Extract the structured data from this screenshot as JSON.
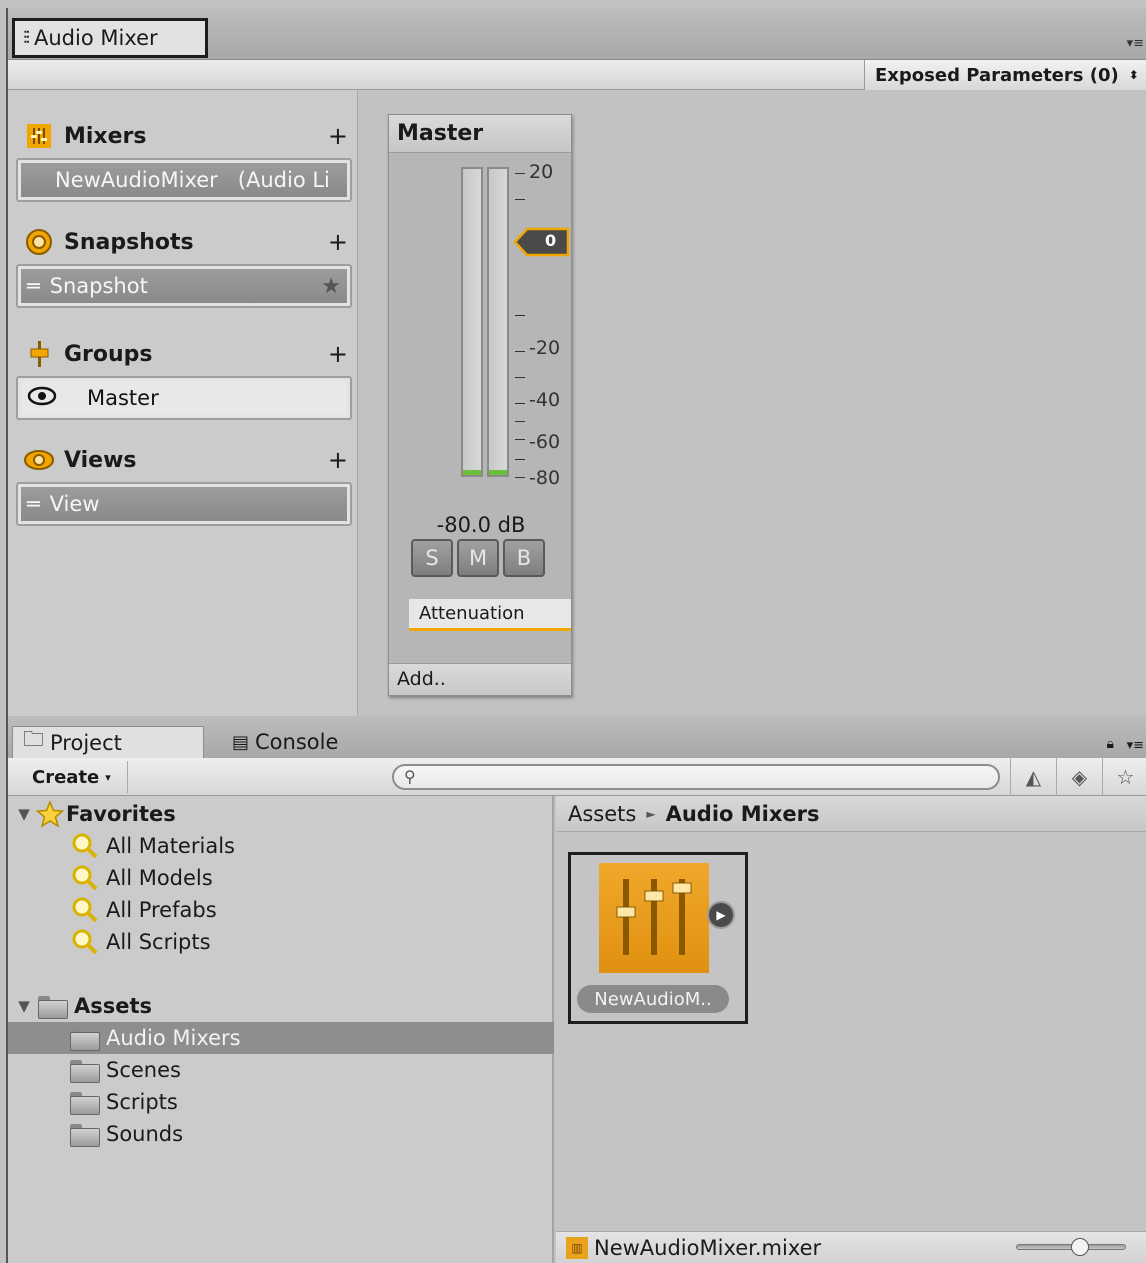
{
  "mixer_window": {
    "tab_title": "Audio Mixer",
    "exposed_parameters": "Exposed Parameters (0)",
    "sections": {
      "mixers": {
        "title": "Mixers",
        "item_name": "NewAudioMixer",
        "item_suffix": "(Audio Li"
      },
      "snapshots": {
        "title": "Snapshots",
        "item": "Snapshot"
      },
      "groups": {
        "title": "Groups",
        "item": "Master"
      },
      "views": {
        "title": "Views",
        "item": "View"
      }
    },
    "plus": "+",
    "master_strip": {
      "title": "Master",
      "scale": [
        "20",
        "-20",
        "-40",
        "-60",
        "-80"
      ],
      "fader_value": "0",
      "level": "-80.0 dB",
      "buttons": [
        "S",
        "M",
        "B"
      ],
      "effect": "Attenuation",
      "add_label": "Add.."
    }
  },
  "project_window": {
    "tabs": [
      "Project",
      "Console"
    ],
    "create_label": "Create",
    "search_placeholder": "",
    "tree": {
      "favorites_title": "Favorites",
      "favorites": [
        "All Materials",
        "All Models",
        "All Prefabs",
        "All Scripts"
      ],
      "assets_title": "Assets",
      "assets": [
        "Audio Mixers",
        "Scenes",
        "Scripts",
        "Sounds"
      ]
    },
    "breadcrumb": {
      "root": "Assets",
      "current": "Audio Mixers"
    },
    "asset_tile_label": "NewAudioM..",
    "status_file": "NewAudioMixer.mixer"
  },
  "colors": {
    "accent": "#f0a500",
    "selection": "#8e8e8e",
    "meter_floor": "#6bbf3a"
  }
}
